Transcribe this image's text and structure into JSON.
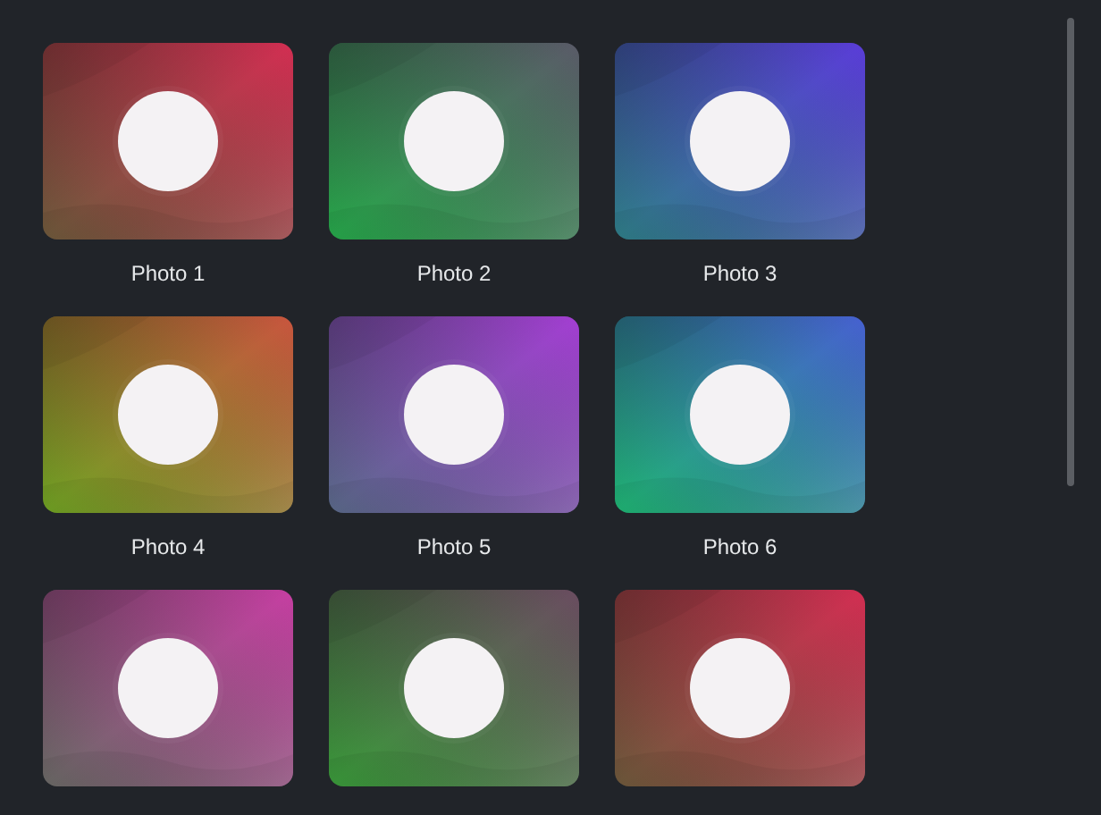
{
  "photos": [
    {
      "kind": "picture",
      "caption": "Photo 1"
    },
    {
      "kind": "picture",
      "caption": "Photo 2"
    },
    {
      "kind": "picture",
      "caption": "Photo 3"
    },
    {
      "kind": "picture",
      "caption": "Photo 4"
    },
    {
      "kind": "picture",
      "caption": "Photo 5"
    },
    {
      "kind": "picture",
      "caption": "Photo 6"
    },
    {
      "kind": "picture"
    },
    {
      "kind": "picture"
    },
    {
      "kind": "picture"
    }
  ]
}
